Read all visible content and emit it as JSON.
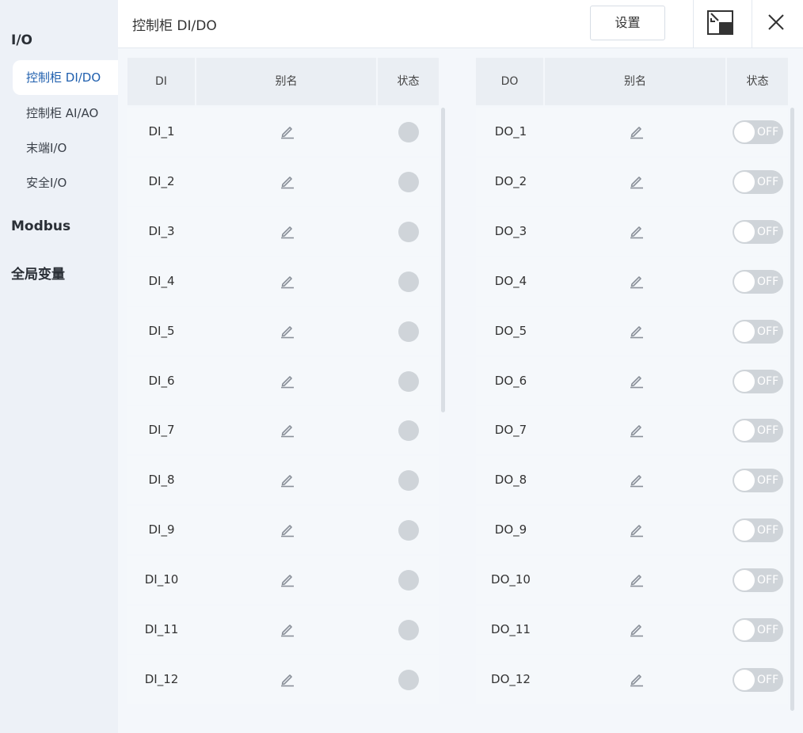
{
  "sidebar": {
    "group_io": "I/O",
    "items": [
      {
        "label": "控制柜 DI/DO",
        "active": true
      },
      {
        "label": "控制柜 AI/AO",
        "active": false
      },
      {
        "label": "末端I/O",
        "active": false
      },
      {
        "label": "安全I/O",
        "active": false
      }
    ],
    "group_modbus": "Modbus",
    "group_global": "全局变量"
  },
  "header": {
    "title": "控制柜 DI/DO",
    "settings_label": "设置",
    "restore_icon": "restore-window-icon",
    "close_icon": "close-icon"
  },
  "di_table": {
    "col_name": "DI",
    "col_alias": "别名",
    "col_status": "状态",
    "rows": [
      "DI_1",
      "DI_2",
      "DI_3",
      "DI_4",
      "DI_5",
      "DI_6",
      "DI_7",
      "DI_8",
      "DI_9",
      "DI_10",
      "DI_11",
      "DI_12"
    ]
  },
  "do_table": {
    "col_name": "DO",
    "col_alias": "别名",
    "col_status": "状态",
    "toggle_label": "OFF",
    "rows": [
      "DO_1",
      "DO_2",
      "DO_3",
      "DO_4",
      "DO_5",
      "DO_6",
      "DO_7",
      "DO_8",
      "DO_9",
      "DO_10",
      "DO_11",
      "DO_12"
    ]
  },
  "colors": {
    "accent": "#1f5fae",
    "status_off": "#cfd4d9"
  }
}
